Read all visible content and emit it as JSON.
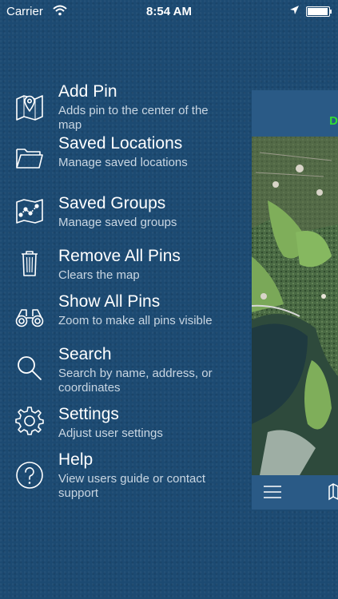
{
  "status_bar": {
    "carrier": "Carrier",
    "time": "8:54 AM"
  },
  "menu": [
    {
      "title": "Add Pin",
      "desc": "Adds pin to the center of the map",
      "icon": "map-pin-icon"
    },
    {
      "title": "Saved Locations",
      "desc": "Manage saved locations",
      "icon": "folder-icon"
    },
    {
      "title": "Saved Groups",
      "desc": "Manage saved groups",
      "icon": "group-map-icon"
    },
    {
      "title": "Remove All Pins",
      "desc": "Clears the map",
      "icon": "trash-icon"
    },
    {
      "title": "Show All Pins",
      "desc": "Zoom to make all pins visible",
      "icon": "binoculars-icon"
    },
    {
      "title": "Search",
      "desc": "Search by name, address, or coordinates",
      "icon": "search-icon"
    },
    {
      "title": "Settings",
      "desc": "Adjust user settings",
      "icon": "gear-icon"
    },
    {
      "title": "Help",
      "desc": "View users guide or contact support",
      "icon": "help-icon"
    }
  ],
  "map": {
    "header_label": "D"
  },
  "colors": {
    "background": "#1c4a72",
    "accent_green": "#33dd33"
  }
}
